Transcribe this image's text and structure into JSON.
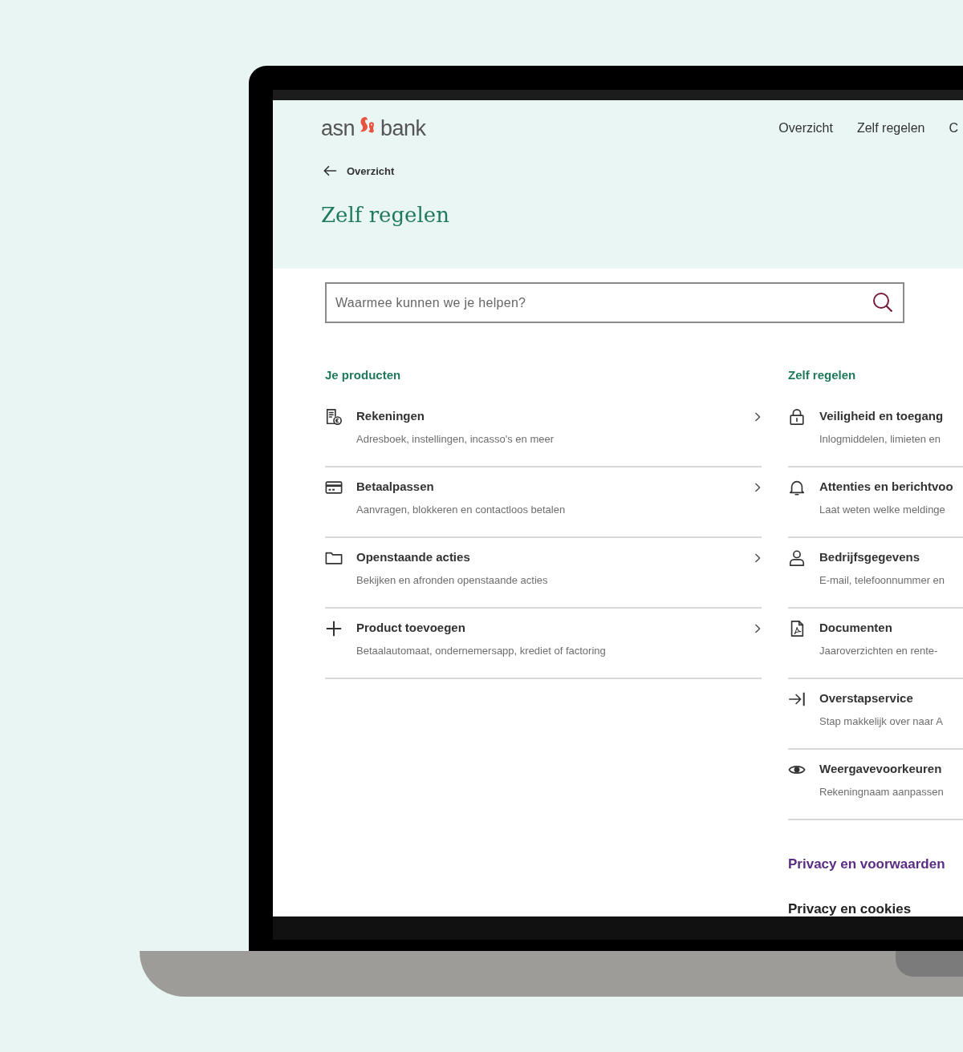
{
  "header": {
    "logo": {
      "left": "asn",
      "right": "bank"
    },
    "nav": [
      {
        "label": "Overzicht"
      },
      {
        "label": "Zelf regelen"
      },
      {
        "label": "C"
      }
    ],
    "back_link": "Overzicht",
    "title": "Zelf regelen"
  },
  "search": {
    "placeholder": "Waarmee kunnen we je helpen?"
  },
  "products": {
    "heading": "Je producten",
    "items": [
      {
        "kind": "receipt",
        "title": "Rekeningen",
        "subtitle": "Adresboek, instellingen, incasso's en meer"
      },
      {
        "kind": "card",
        "title": "Betaalpassen",
        "subtitle": "Aanvragen, blokkeren en contactloos betalen"
      },
      {
        "kind": "folder",
        "title": "Openstaande acties",
        "subtitle": "Bekijken en afronden openstaande acties"
      },
      {
        "kind": "plus",
        "title": "Product toevoegen",
        "subtitle": "Betaalautomaat, ondernemersapp, krediet of factoring"
      }
    ]
  },
  "self_service": {
    "heading": "Zelf regelen",
    "items": [
      {
        "kind": "lock",
        "title": "Veiligheid en toegang",
        "subtitle": "Inlogmiddelen, limieten en"
      },
      {
        "kind": "bell",
        "title": "Attenties en berichtvoo",
        "subtitle": "Laat weten welke meldinge"
      },
      {
        "kind": "person",
        "title": "Bedrijfsgegevens",
        "subtitle": "E-mail, telefoonnummer en"
      },
      {
        "kind": "pdf",
        "title": "Documenten",
        "subtitle": "Jaaroverzichten en rente-"
      },
      {
        "kind": "switch",
        "title": "Overstapservice",
        "subtitle": "Stap makkelijk over naar A"
      },
      {
        "kind": "eye",
        "title": "Weergavevoorkeuren",
        "subtitle": "Rekeningnaam aanpassen"
      }
    ]
  },
  "privacy": {
    "heading": "Privacy en voorwaarden",
    "links": [
      "Privacy en cookies"
    ]
  }
}
